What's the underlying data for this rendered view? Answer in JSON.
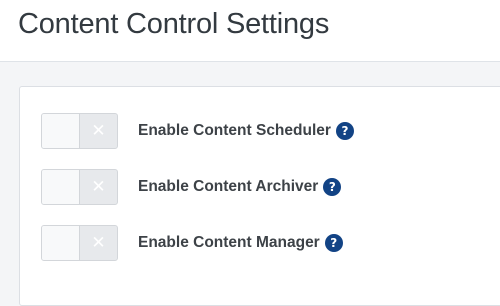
{
  "page": {
    "title": "Content Control Settings"
  },
  "colors": {
    "help_icon": "#124385",
    "label_text": "#3d4247",
    "toggle_off_bg": "#e7e9ec"
  },
  "settings": [
    {
      "label": "Enable Content Scheduler",
      "enabled": false,
      "toggle_icon": "x-icon",
      "help_icon": "question-circle-icon",
      "help_glyph": "?"
    },
    {
      "label": "Enable Content Archiver",
      "enabled": false,
      "toggle_icon": "x-icon",
      "help_icon": "question-circle-icon",
      "help_glyph": "?"
    },
    {
      "label": "Enable Content Manager",
      "enabled": false,
      "toggle_icon": "x-icon",
      "help_icon": "question-circle-icon",
      "help_glyph": "?"
    }
  ]
}
